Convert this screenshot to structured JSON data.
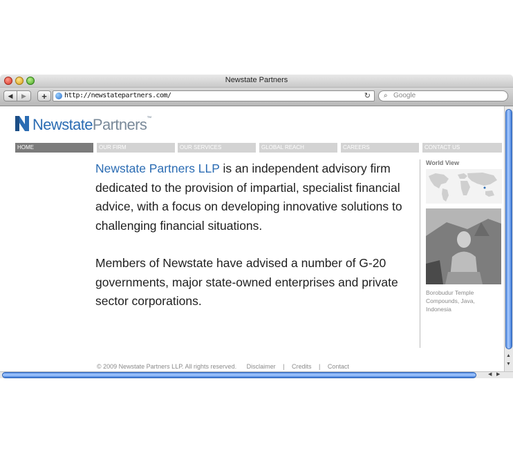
{
  "window": {
    "title": "Newstate Partners"
  },
  "toolbar": {
    "back": "◀",
    "forward": "▶",
    "add": "+",
    "url": "http://newstatepartners.com/",
    "reload": "↻",
    "search_placeholder": "Google"
  },
  "site": {
    "logo_part1": "Newstate",
    "logo_part2": "Partners",
    "logo_tm": "™",
    "nav": [
      {
        "label": "HOME"
      },
      {
        "label": "OUR FIRM"
      },
      {
        "label": "OUR SERVICES"
      },
      {
        "label": "GLOBAL REACH"
      },
      {
        "label": "CAREERS"
      },
      {
        "label": "CONTACT US"
      }
    ],
    "intro_lead": "Newstate Partners LLP",
    "intro_rest": " is an independent advisory firm dedicated to the provision of impartial, specialist financial advice, with a focus on developing innovative solutions to challenging financial situations.",
    "paragraph2": "Members of Newstate have advised a number of G-20 governments, major state-owned enterprises and private sector corporations.",
    "sidebar": {
      "title": "World View",
      "caption": "Borobudur Temple Compounds, Java, Indonesia"
    },
    "footer": {
      "copyright": "© 2009 Newstate Partners LLP. All rights reserved.",
      "disclaimer": "Disclaimer",
      "credits": "Credits",
      "contact": "Contact",
      "separator": "|"
    }
  },
  "colors": {
    "brand_blue": "#2b6cb3",
    "nav_active": "#7b7b7b",
    "nav_inactive": "#d3d3d3"
  }
}
